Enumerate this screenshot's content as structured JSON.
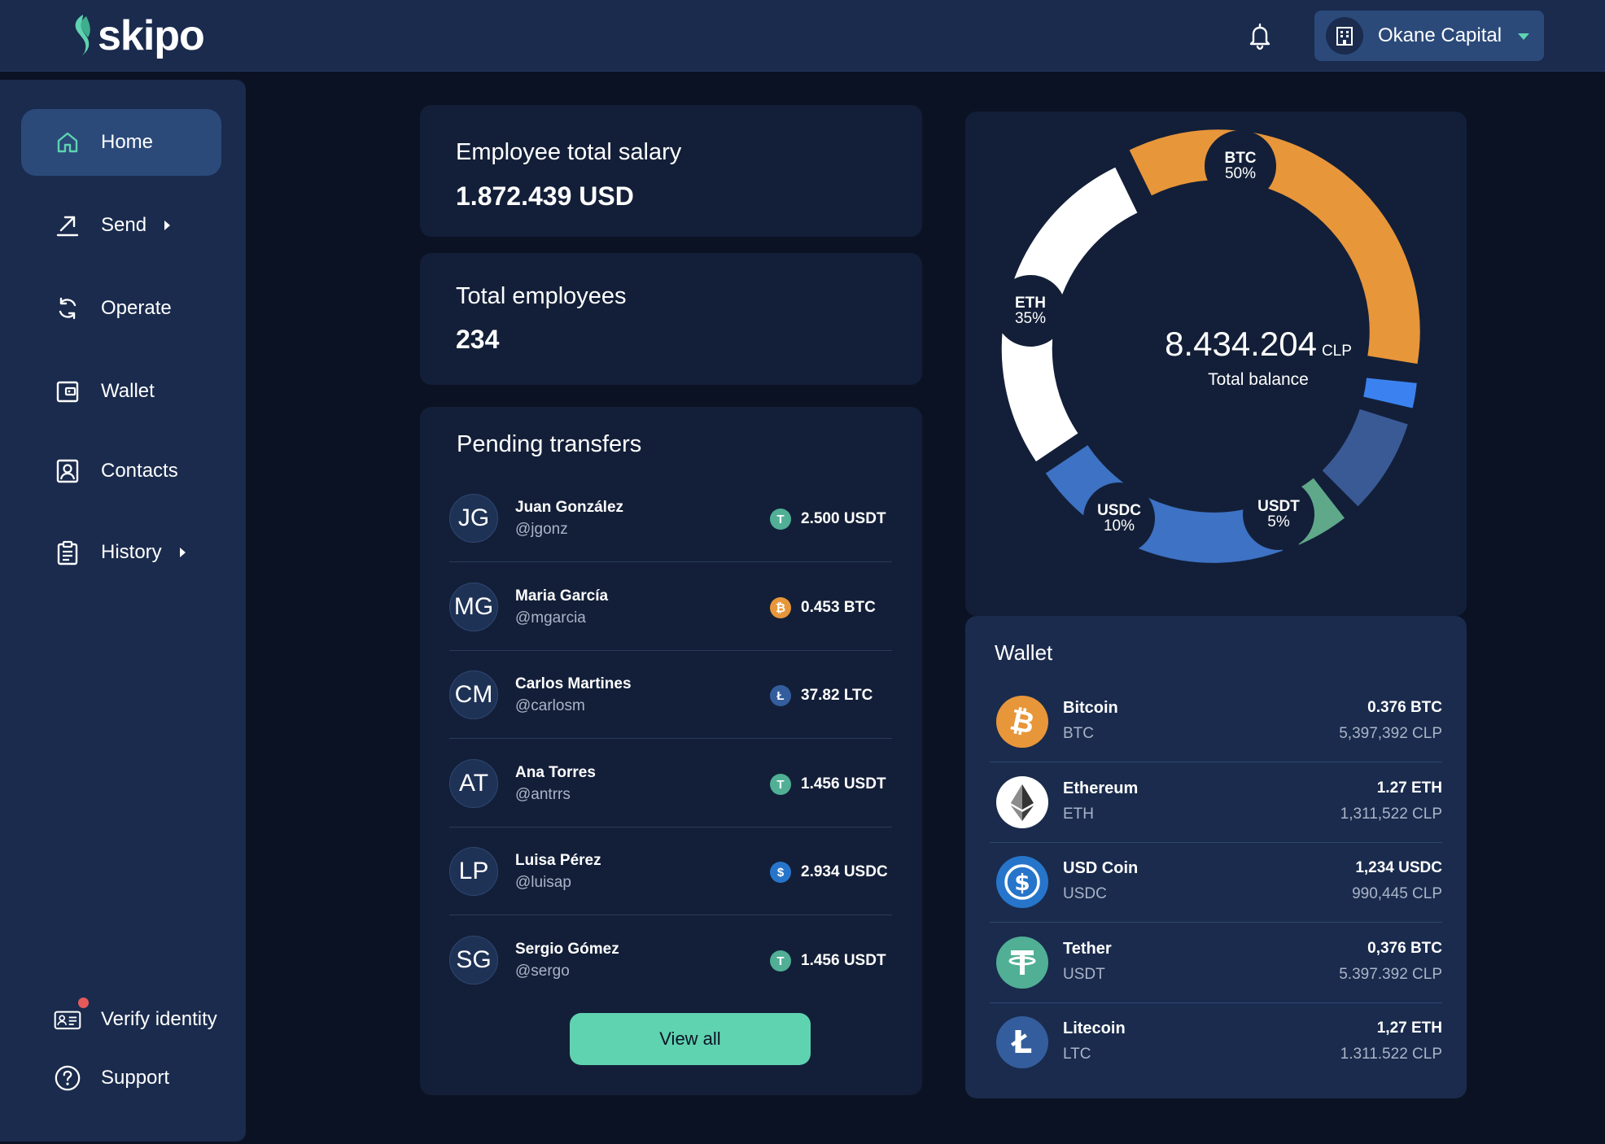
{
  "brand": {
    "name": "skipo",
    "accent": "#5fd3b0"
  },
  "header": {
    "org_name": "Okane Capital"
  },
  "sidebar": {
    "items": [
      {
        "label": "Home",
        "icon": "home-icon",
        "active": true
      },
      {
        "label": "Send",
        "icon": "send-icon",
        "has_submenu": true
      },
      {
        "label": "Operate",
        "icon": "refresh-icon"
      },
      {
        "label": "Wallet",
        "icon": "wallet-icon"
      },
      {
        "label": "Contacts",
        "icon": "contact-card-icon"
      },
      {
        "label": "History",
        "icon": "clipboard-icon",
        "has_submenu": true
      }
    ],
    "bottom": [
      {
        "label": "Verify identity",
        "icon": "id-card-icon",
        "notification": true
      },
      {
        "label": "Support",
        "icon": "help-icon"
      }
    ]
  },
  "stats": {
    "salary": {
      "title": "Employee total salary",
      "value": "1.872.439 USD"
    },
    "employees": {
      "title": "Total employees",
      "value": "234"
    }
  },
  "pending": {
    "title": "Pending transfers",
    "view_all_label": "View all",
    "transfers": [
      {
        "initials": "JG",
        "name": "Juan González",
        "handle": "@jgonz",
        "coin": "USDT",
        "amount": "2.500 USDT"
      },
      {
        "initials": "MG",
        "name": "Maria García",
        "handle": "@mgarcia",
        "coin": "BTC",
        "amount": "0.453 BTC"
      },
      {
        "initials": "CM",
        "name": "Carlos Martines",
        "handle": "@carlosm",
        "coin": "LTC",
        "amount": "37.82 LTC"
      },
      {
        "initials": "AT",
        "name": "Ana Torres",
        "handle": "@antrrs",
        "coin": "USDT",
        "amount": "1.456 USDT"
      },
      {
        "initials": "LP",
        "name": "Luisa Pérez",
        "handle": "@luisap",
        "coin": "USDC",
        "amount": "2.934 USDC"
      },
      {
        "initials": "SG",
        "name": "Sergio Gómez",
        "handle": "@sergo",
        "coin": "USDT",
        "amount": "1.456 USDT"
      }
    ]
  },
  "balance": {
    "value": "8.434.204",
    "unit": "CLP",
    "label": "Total balance",
    "segments": [
      {
        "symbol": "BTC",
        "pct_label": "50%",
        "color": "#e8963a"
      },
      {
        "symbol": "ETH",
        "pct_label": "35%",
        "color": "#ffffff"
      },
      {
        "symbol": "USDC",
        "pct_label": "10%",
        "color": "#3d72c4"
      },
      {
        "symbol": "USDT",
        "pct_label": "5%",
        "color": "#5fa88a"
      }
    ],
    "extra_colors": {
      "blue_bright": "#3b82f0",
      "blue_slate": "#3a5a96"
    }
  },
  "wallet": {
    "title": "Wallet",
    "assets": [
      {
        "name": "Bitcoin",
        "symbol": "BTC",
        "amount": "0.376 BTC",
        "fiat": "5,397,392 CLP",
        "icon": "bitcoin-icon",
        "color": "#e8963a"
      },
      {
        "name": "Ethereum",
        "symbol": "ETH",
        "amount": "1.27 ETH",
        "fiat": "1,311,522 CLP",
        "icon": "ethereum-icon",
        "color": "#ffffff"
      },
      {
        "name": "USD Coin",
        "symbol": "USDC",
        "amount": "1,234 USDC",
        "fiat": "990,445 CLP",
        "icon": "usdc-icon",
        "color": "#2775ca"
      },
      {
        "name": "Tether",
        "symbol": "USDT",
        "amount": "0,376 BTC",
        "fiat": "5.397.392 CLP",
        "icon": "tether-icon",
        "color": "#50af95"
      },
      {
        "name": "Litecoin",
        "symbol": "LTC",
        "amount": "1,27 ETH",
        "fiat": "1.311.522 CLP",
        "icon": "litecoin-icon",
        "color": "#345d9d"
      }
    ]
  }
}
